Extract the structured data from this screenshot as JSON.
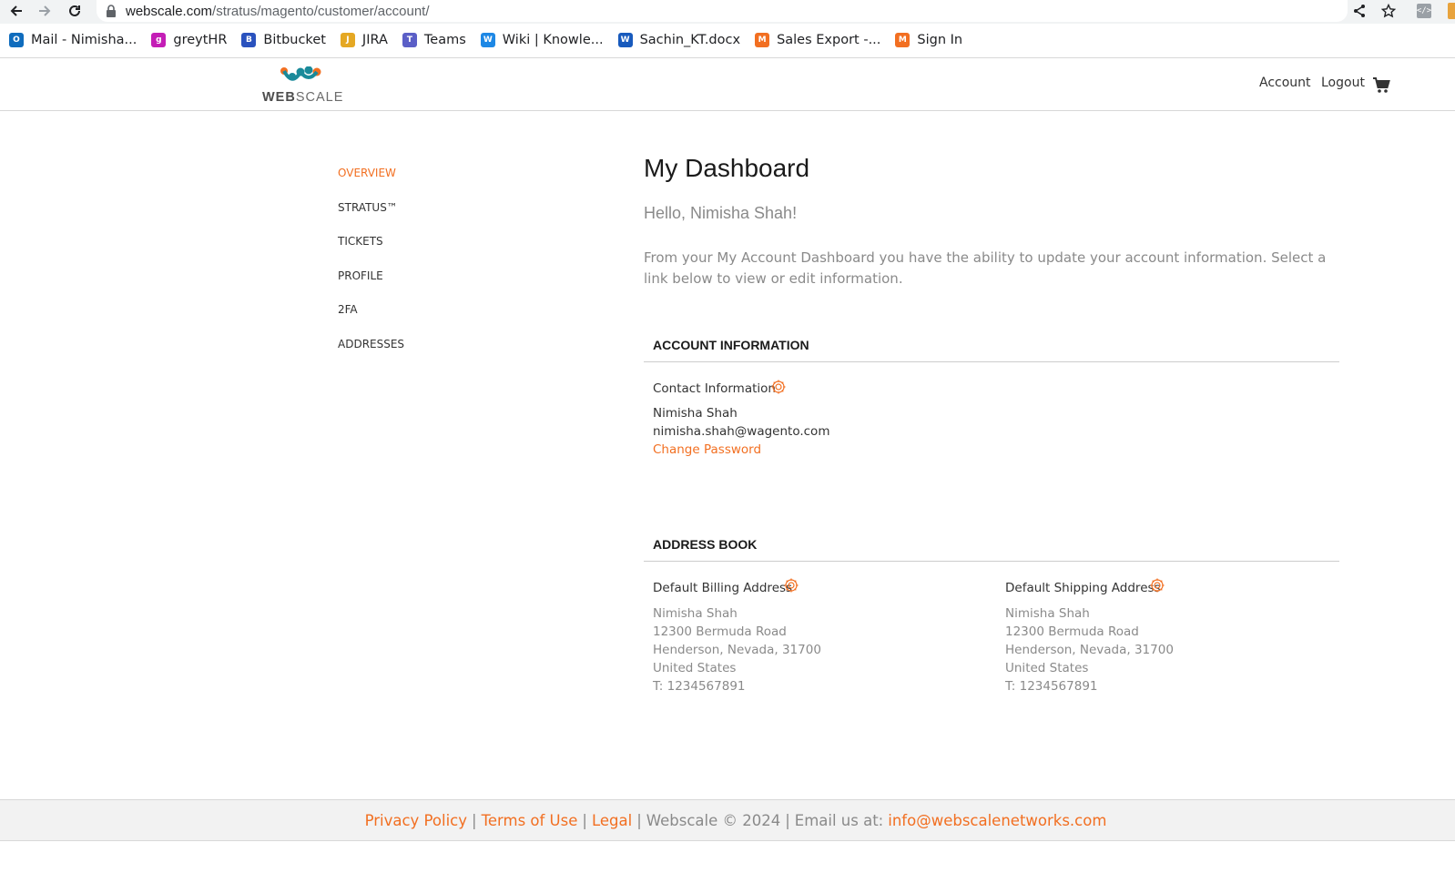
{
  "browser": {
    "url_host": "webscale.com",
    "url_path": "/stratus/magento/customer/account/",
    "bookmarks": [
      {
        "label": "Mail - Nimisha...",
        "icon": "outlook-icon",
        "color": "#0f6cbd"
      },
      {
        "label": "greytHR",
        "icon": "greythr-icon",
        "color": "#c41eb6"
      },
      {
        "label": "Bitbucket",
        "icon": "bitbucket-icon",
        "color": "#2a52be"
      },
      {
        "label": "JIRA",
        "icon": "jira-icon",
        "color": "#e5a823"
      },
      {
        "label": "Teams",
        "icon": "teams-icon",
        "color": "#5b5fc7"
      },
      {
        "label": "Wiki | Knowle...",
        "icon": "wiki-icon",
        "color": "#1e88e5"
      },
      {
        "label": "Sachin_KT.docx",
        "icon": "word-icon",
        "color": "#185abd"
      },
      {
        "label": "Sales Export -...",
        "icon": "magento-icon",
        "color": "#f26f21"
      },
      {
        "label": "Sign In",
        "icon": "magento-icon",
        "color": "#f26f21"
      }
    ]
  },
  "header": {
    "logo_bold": "WEB",
    "logo_light": "SCALE",
    "account_link": "Account",
    "logout_link": "Logout"
  },
  "sidebar": {
    "items": [
      {
        "label": "OVERVIEW",
        "active": true
      },
      {
        "label": "STRATUS™",
        "active": false
      },
      {
        "label": "TICKETS",
        "active": false
      },
      {
        "label": "PROFILE",
        "active": false
      },
      {
        "label": "2FA",
        "active": false
      },
      {
        "label": "ADDRESSES",
        "active": false
      }
    ]
  },
  "main": {
    "title": "My Dashboard",
    "greeting": "Hello, Nimisha Shah!",
    "intro": "From your My Account Dashboard you have the ability to update your account information. Select a link below to view or edit information.",
    "account_info": {
      "section_title": "ACCOUNT INFORMATION",
      "box_title": "Contact Information",
      "name": "Nimisha Shah",
      "email": "nimisha.shah@wagento.com",
      "change_password": "Change Password"
    },
    "address_book": {
      "section_title": "ADDRESS BOOK",
      "billing": {
        "title": "Default Billing Address",
        "name": "Nimisha Shah",
        "street": "12300 Bermuda Road",
        "city_line": "Henderson, Nevada, 31700",
        "country": "United States",
        "phone": "T: 1234567891"
      },
      "shipping": {
        "title": "Default Shipping Address",
        "name": "Nimisha Shah",
        "street": "12300 Bermuda Road",
        "city_line": "Henderson, Nevada, 31700",
        "country": "United States",
        "phone": "T: 1234567891"
      }
    }
  },
  "footer": {
    "privacy": "Privacy Policy",
    "terms": "Terms of Use",
    "legal": "Legal",
    "separator": "|",
    "copyright": "Webscale © 2024",
    "email_prefix": "Email us at:",
    "email": "info@webscalenetworks.com"
  },
  "colors": {
    "accent": "#f26f21",
    "muted_text": "#8a8a8a",
    "logo_teal": "#1a8a9a",
    "logo_orange": "#f26f21"
  }
}
